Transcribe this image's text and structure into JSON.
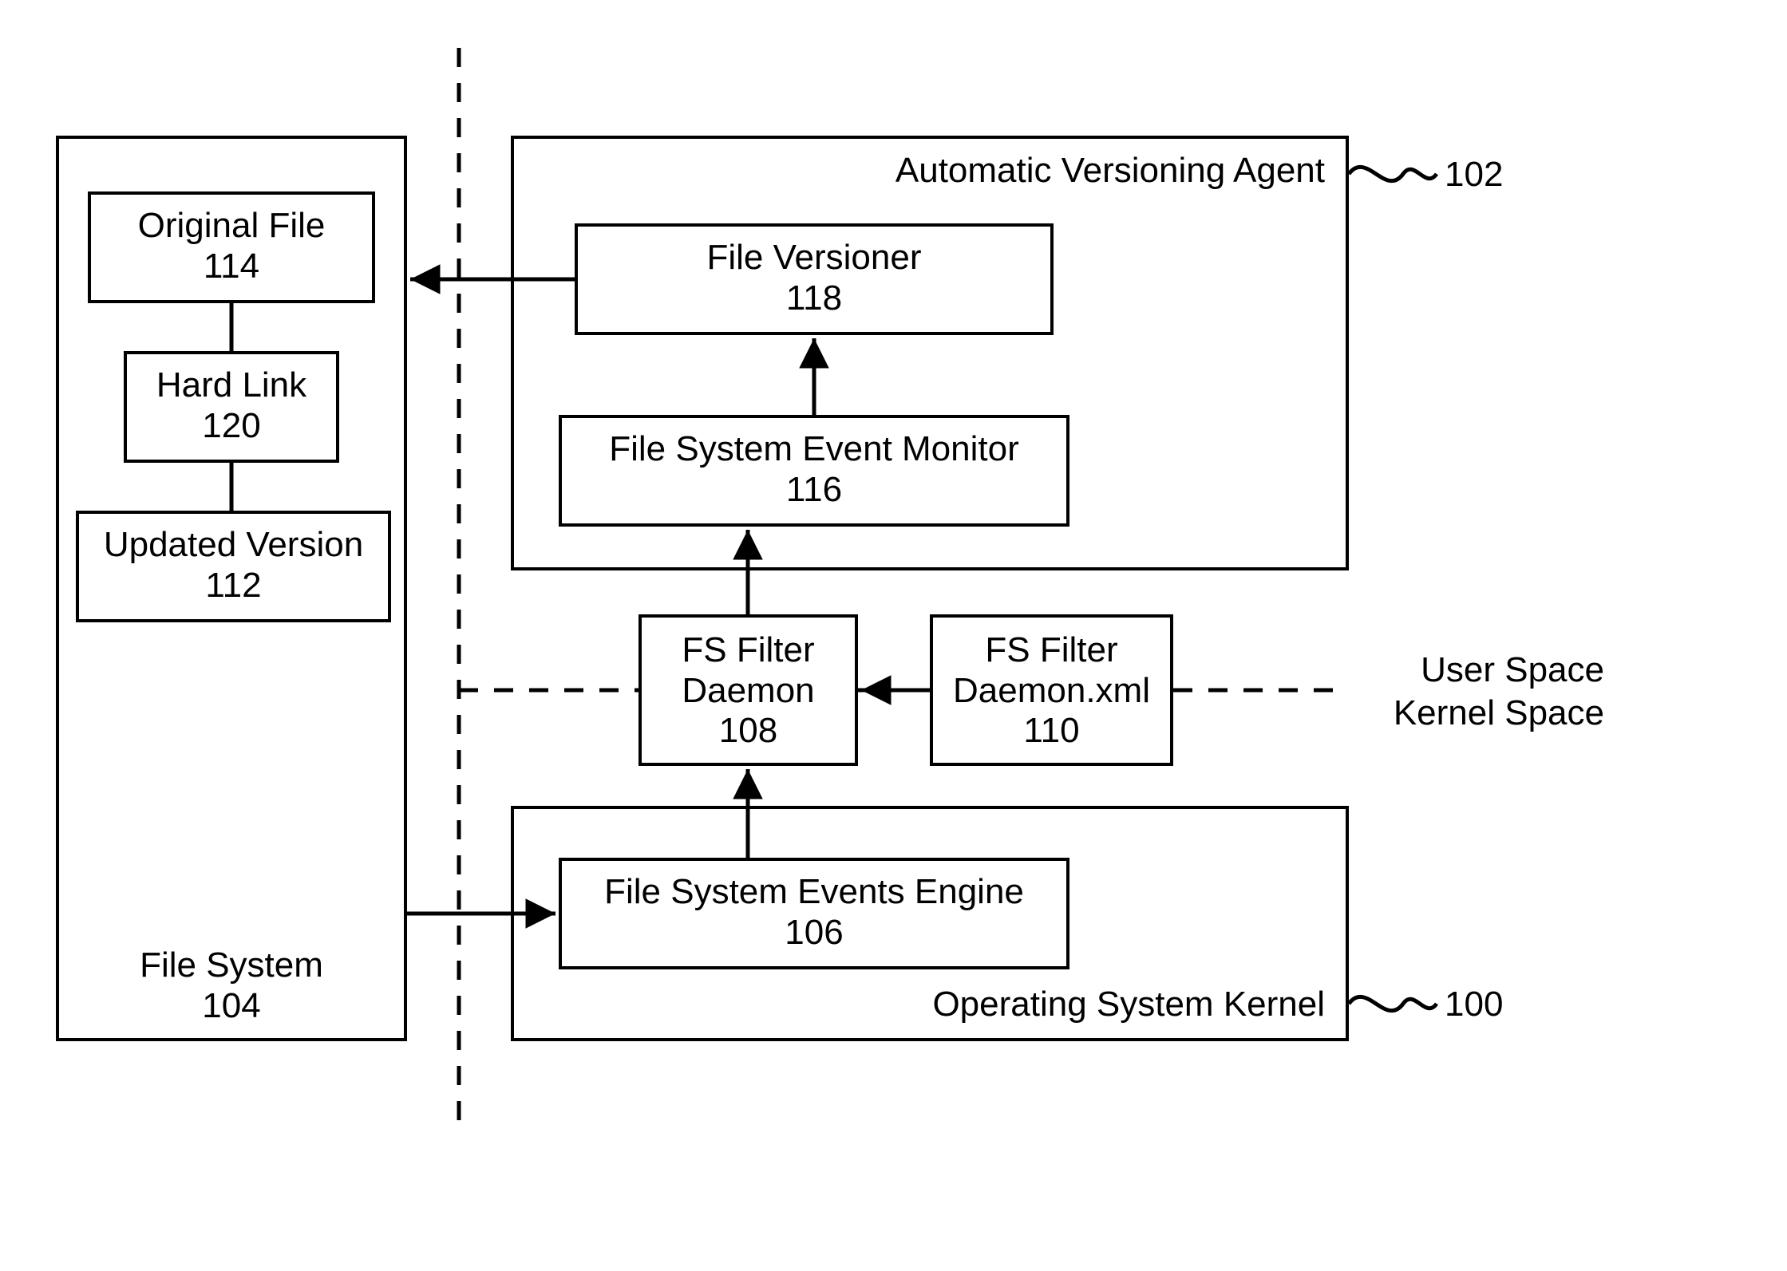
{
  "fileSystem": {
    "container_label": "File System",
    "container_num": "104",
    "original_file": {
      "label": "Original File",
      "num": "114"
    },
    "hard_link": {
      "label": "Hard Link",
      "num": "120"
    },
    "updated": {
      "label": "Updated Version",
      "num": "112"
    }
  },
  "agent": {
    "container_label": "Automatic Versioning Agent",
    "container_num": "102",
    "versioner": {
      "label": "File Versioner",
      "num": "118"
    },
    "monitor": {
      "label": "File System Event Monitor",
      "num": "116"
    }
  },
  "daemon": {
    "l1": "FS Filter",
    "l2": "Daemon",
    "num": "108"
  },
  "daemon_xml": {
    "l1": "FS Filter",
    "l2": "Daemon.xml",
    "num": "110"
  },
  "kernel": {
    "container_label": "Operating System Kernel",
    "container_num": "100",
    "events_engine": {
      "label": "File System Events Engine",
      "num": "106"
    }
  },
  "divider": {
    "user": "User Space",
    "kernel": "Kernel Space"
  }
}
